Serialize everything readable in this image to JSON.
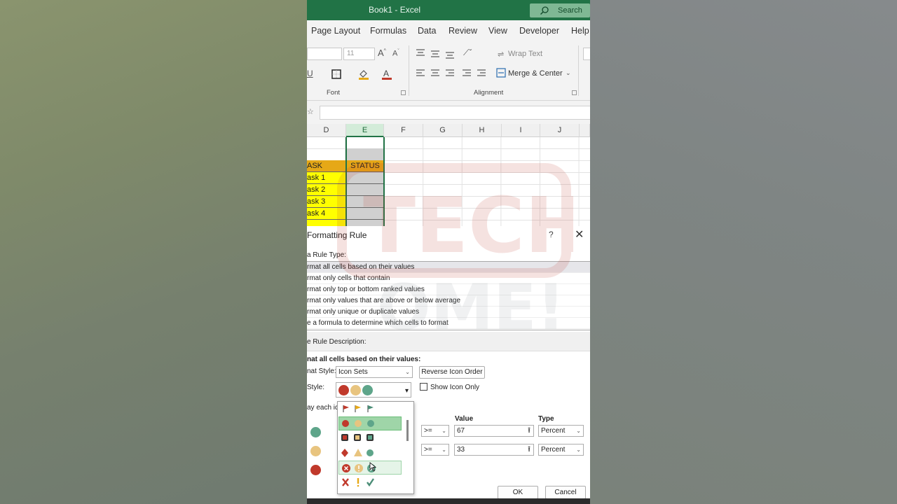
{
  "window": {
    "title": "Book1  -  Excel",
    "search_label": "Search"
  },
  "ribbon": {
    "tabs": [
      "Page Layout",
      "Formulas",
      "Data",
      "Review",
      "View",
      "Developer",
      "Help"
    ],
    "font_size": "11",
    "wrap_text": "Wrap Text",
    "merge_center": "Merge & Center",
    "font_group": "Font",
    "alignment_group": "Alignment"
  },
  "sheet": {
    "columns": [
      "D",
      "E",
      "F",
      "G",
      "H",
      "I",
      "J"
    ],
    "selected_column": "E",
    "header_task": "ASK",
    "header_status": "STATUS",
    "tasks": [
      "ask 1",
      "ask 2",
      "ask 3",
      "ask 4"
    ]
  },
  "dialog": {
    "title": "Formatting Rule",
    "help": "?",
    "rule_type_label": "a Rule Type:",
    "rule_types": [
      "rmat all cells based on their values",
      "rmat only cells that contain",
      "rmat only top or bottom ranked values",
      "rmat only values that are above or below average",
      "rmat only unique or duplicate values",
      "e a formula to determine which cells to format"
    ],
    "rule_desc_label": "e Rule Description:",
    "format_all_label": "nat all cells based on their values:",
    "format_style_label": "nat Style:",
    "format_style_value": "Icon Sets",
    "reverse_icon_order": "Reverse Icon Order",
    "icon_style_label": "Style:",
    "show_icon_only": "Show Icon Only",
    "display_each_label": "ay each ic",
    "value_header": "Value",
    "type_header": "Type",
    "rows": [
      {
        "operator": ">=",
        "value": "67",
        "type": "Percent"
      },
      {
        "operator": ">=",
        "value": "33",
        "type": "Percent"
      }
    ],
    "ok": "OK",
    "cancel": "Cancel"
  },
  "colors": {
    "excel_green": "#217346",
    "icon_red": "#c0392b",
    "icon_yellow": "#e8b24a",
    "icon_green": "#5ea58a",
    "task_yellow": "#ffff00",
    "header_gold": "#e6a817"
  }
}
